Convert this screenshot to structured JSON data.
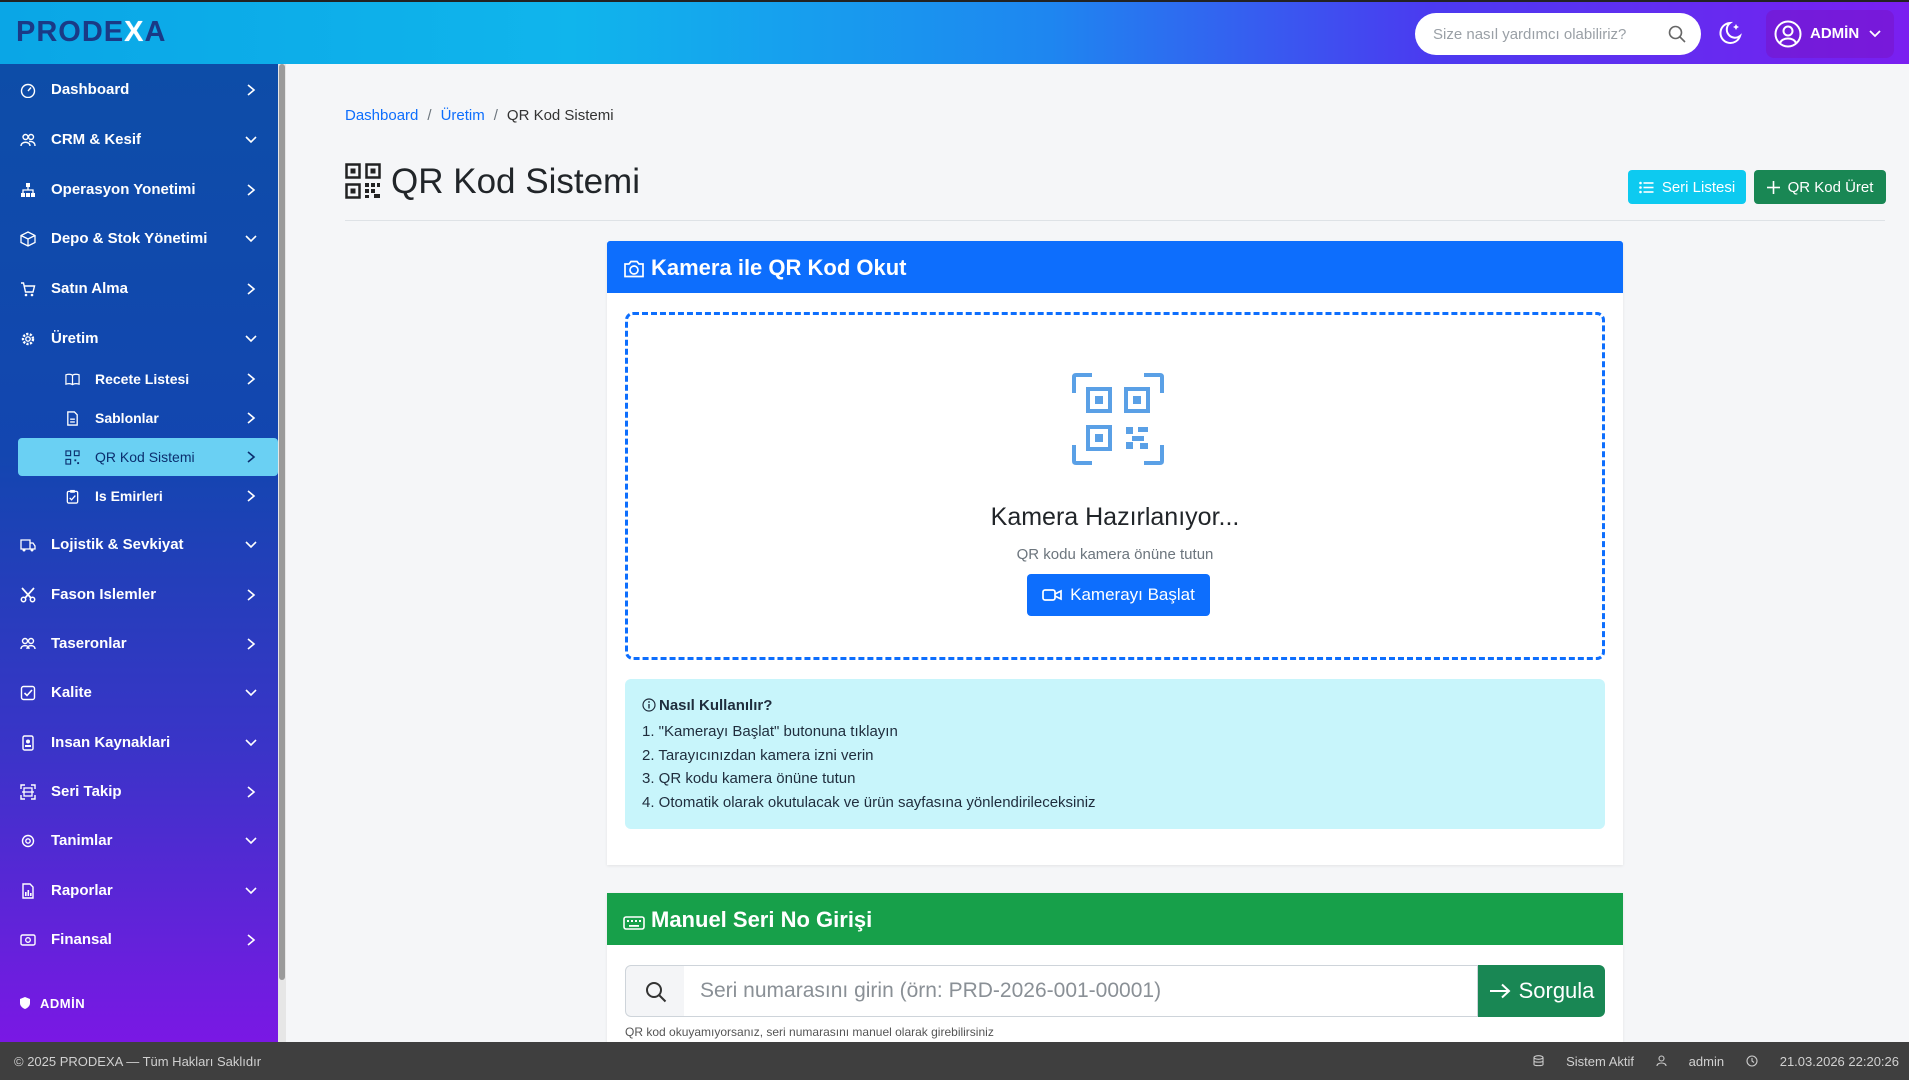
{
  "app": {
    "logo_main": "PRODE",
    "logo_x": "X",
    "logo_end": "A"
  },
  "topbar": {
    "search_placeholder": "Size nasıl yardımcı olabiliriz?",
    "user_label": "ADMİN"
  },
  "sidebar": {
    "items": [
      {
        "label": "Dashboard",
        "icon": "dashboard-icon",
        "chevron": "right"
      },
      {
        "label": "CRM & Kesif",
        "icon": "users-icon",
        "chevron": "down"
      },
      {
        "label": "Operasyon Yonetimi",
        "icon": "sitemap-icon",
        "chevron": "right"
      },
      {
        "label": "Depo & Stok Yönetimi",
        "icon": "box-icon",
        "chevron": "down"
      },
      {
        "label": "Satın Alma",
        "icon": "cart-icon",
        "chevron": "right"
      },
      {
        "label": "Üretim",
        "icon": "cog-icon",
        "chevron": "down"
      },
      {
        "label": "Lojistik & Sevkiyat",
        "icon": "truck-icon",
        "chevron": "down"
      },
      {
        "label": "Fason Islemler",
        "icon": "scissors-icon",
        "chevron": "right"
      },
      {
        "label": "Taseronlar",
        "icon": "people-icon",
        "chevron": "right"
      },
      {
        "label": "Kalite",
        "icon": "check-square-icon",
        "chevron": "down"
      },
      {
        "label": "Insan Kaynaklari",
        "icon": "id-badge-icon",
        "chevron": "down"
      },
      {
        "label": "Seri Takip",
        "icon": "scan-icon",
        "chevron": "right"
      },
      {
        "label": "Tanimlar",
        "icon": "gear-icon",
        "chevron": "down"
      },
      {
        "label": "Raporlar",
        "icon": "report-icon",
        "chevron": "down"
      },
      {
        "label": "Finansal",
        "icon": "money-icon",
        "chevron": "right"
      }
    ],
    "subitems": [
      {
        "label": "Recete Listesi",
        "icon": "book-icon"
      },
      {
        "label": "Sablonlar",
        "icon": "file-icon"
      },
      {
        "label": "QR Kod Sistemi",
        "icon": "qr-icon",
        "active": true
      },
      {
        "label": "Is Emirleri",
        "icon": "clipboard-icon"
      }
    ],
    "footer_user": "ADMİN"
  },
  "breadcrumb": {
    "items": [
      "Dashboard",
      "Üretim"
    ],
    "current": "QR Kod Sistemi"
  },
  "page": {
    "title": "QR Kod Sistemi",
    "btn_seri_listesi": "Seri Listesi",
    "btn_qr_kod_uret": "QR Kod Üret"
  },
  "camera_card": {
    "header": "Kamera ile QR Kod Okut",
    "status_title": "Kamera Hazırlanıyor...",
    "status_sub": "QR kodu kamera önüne tutun",
    "start_button": "Kamerayı Başlat",
    "info_title": "Nasıl Kullanılır?",
    "steps": [
      "1. \"Kamerayı Başlat\" butonuna tıklayın",
      "2. Tarayıcınızdan kamera izni verin",
      "3. QR kodu kamera önüne tutun",
      "4. Otomatik olarak okutulacak ve ürün sayfasına yönlendirileceksiniz"
    ]
  },
  "manual_card": {
    "header": "Manuel Seri No Girişi",
    "input_placeholder": "Seri numarasını girin (örn: PRD-2026-001-00001)",
    "input_value": "",
    "submit_button": "Sorgula",
    "help_text": "QR kod okuyamıyorsanız, seri numarasını manuel olarak girebilirsiniz"
  },
  "footer": {
    "copyright": "© 2025 PRODEXA — Tüm Hakları Saklıdır",
    "status": "Sistem Aktif",
    "user": "admin",
    "datetime": "21.03.2026 22:20:26"
  },
  "colors": {
    "primary": "#0d6efd",
    "success": "#198754",
    "info": "#0dcaf0",
    "sidebar_active": "#6ad0f3"
  }
}
